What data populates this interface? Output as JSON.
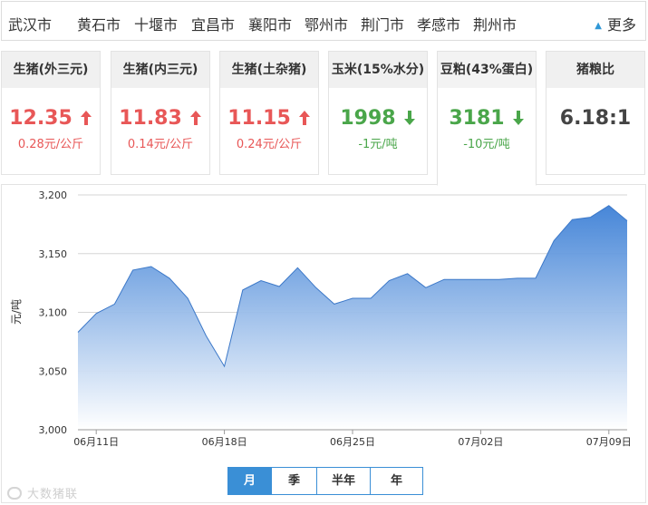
{
  "cities": [
    "武汉市",
    "黄石市",
    "十堰市",
    "宜昌市",
    "襄阳市",
    "鄂州市",
    "荆门市",
    "孝感市",
    "荆州市"
  ],
  "more_label": "更多",
  "cards": [
    {
      "title": "生猪(外三元)",
      "price": "12.35",
      "change": "0.28元/公斤",
      "trend": "up"
    },
    {
      "title": "生猪(内三元)",
      "price": "11.83",
      "change": "0.14元/公斤",
      "trend": "up"
    },
    {
      "title": "生猪(土杂猪)",
      "price": "11.15",
      "change": "0.24元/公斤",
      "trend": "up"
    },
    {
      "title": "玉米(15%水分)",
      "price": "1998",
      "change": "-1元/吨",
      "trend": "down"
    },
    {
      "title": "豆粕(43%蛋白)",
      "price": "3181",
      "change": "-10元/吨",
      "trend": "down"
    },
    {
      "title": "猪粮比",
      "price": "6.18:1",
      "change": "",
      "trend": "none"
    }
  ],
  "active_card": 4,
  "periods": [
    "月",
    "季",
    "半年",
    "年"
  ],
  "active_period": 0,
  "watermark": "大数猪联",
  "colors": {
    "up": "#e85757",
    "down": "#4aa64a",
    "accent": "#3a8fd6",
    "area_top": "#4a8fd8",
    "area_bottom": "#ffffff",
    "line": "#3c78c8"
  },
  "icons": {
    "up": "arrow-up-icon",
    "down": "arrow-down-icon",
    "more": "triangle-up-icon"
  },
  "chart_data": {
    "type": "area",
    "ylabel": "元/吨",
    "ylim": [
      3000,
      3200
    ],
    "yticks": [
      3000,
      3050,
      3100,
      3150,
      3200
    ],
    "ytick_labels": [
      "3,000",
      "3,050",
      "3,100",
      "3,150",
      "3,200"
    ],
    "xtick_labels": [
      "06月11日",
      "06月18日",
      "06月25日",
      "07月02日",
      "07月09日"
    ],
    "xtick_indices": [
      1,
      8,
      15,
      22,
      29
    ],
    "grid": true,
    "series": [
      {
        "values": [
          3083,
          3099,
          3107,
          3136,
          3139,
          3129,
          3112,
          3080,
          3054,
          3119,
          3127,
          3122,
          3138,
          3121,
          3107,
          3112,
          3112,
          3127,
          3133,
          3121,
          3128,
          3128,
          3128,
          3128,
          3129,
          3129,
          3161,
          3179,
          3181,
          3191,
          3178
        ]
      }
    ]
  }
}
